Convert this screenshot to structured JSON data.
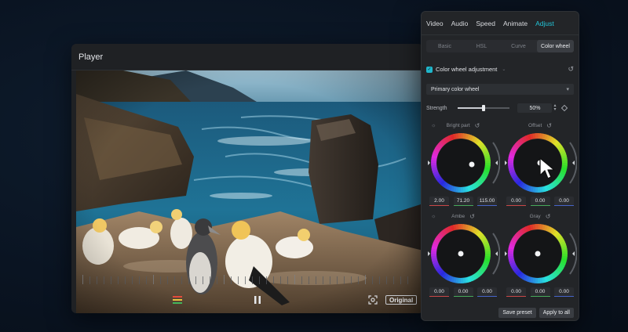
{
  "player": {
    "title": "Player",
    "original_label": "Original",
    "icons": [
      "waveform-icon",
      "pause-icon",
      "fit-screen-icon"
    ]
  },
  "panel": {
    "tabs": [
      {
        "label": "Video",
        "active": false
      },
      {
        "label": "Audio",
        "active": false
      },
      {
        "label": "Speed",
        "active": false
      },
      {
        "label": "Animate",
        "active": false
      },
      {
        "label": "Adjust",
        "active": true
      }
    ],
    "subtabs": [
      {
        "label": "Basic",
        "active": false
      },
      {
        "label": "HSL",
        "active": false
      },
      {
        "label": "Curve",
        "active": false
      },
      {
        "label": "Color wheel",
        "active": true
      }
    ],
    "color_wheel_adjustment": {
      "label": "Color wheel adjustment",
      "checked": true
    },
    "wheel_type": {
      "selected": "Primary color wheel"
    },
    "strength": {
      "label": "Strength",
      "value": "50%",
      "level": 0.5
    },
    "wheels": [
      {
        "label": "Bright part",
        "values": [
          "2.00",
          "71.20",
          "115.00"
        ]
      },
      {
        "label": "Offset",
        "values": [
          "0.00",
          "0.00",
          "0.00"
        ]
      },
      {
        "label": "Ambe",
        "values": [
          "0.00",
          "0.00",
          "0.00"
        ]
      },
      {
        "label": "Gray",
        "values": [
          "0.00",
          "0.00",
          "0.00"
        ]
      }
    ],
    "buttons": {
      "save_preset": "Save preset",
      "apply_to_all": "Apply to all"
    }
  },
  "colors": {
    "accent": "#23c6d9",
    "panel_bg": "#232528",
    "player_bg": "#1f2124"
  }
}
